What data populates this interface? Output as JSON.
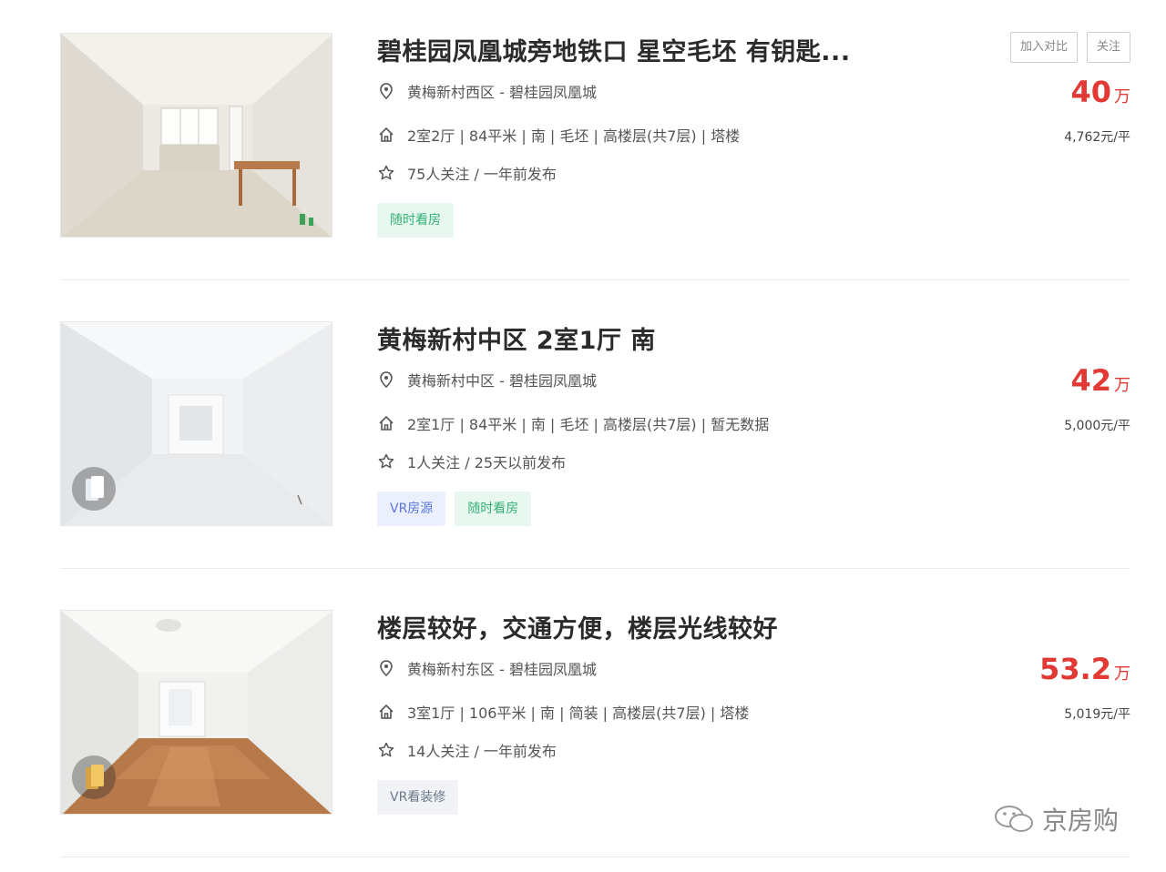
{
  "listings": [
    {
      "title": "碧桂园凤凰城旁地铁口 星空毛坯 有钥匙...",
      "location": "黄梅新村西区 - 碧桂园凤凰城",
      "specs": "2室2厅 | 84平米 | 南 | 毛坯 | 高楼层(共7层) | 塔楼",
      "followers": "75人关注 / 一年前发布",
      "tags": [
        "随时看房"
      ],
      "price": "40",
      "price_unit": "万",
      "unit_price": "4,762元/平",
      "actions": [
        "加入对比",
        "关注"
      ]
    },
    {
      "title": "黄梅新村中区 2室1厅 南",
      "location": "黄梅新村中区 - 碧桂园凤凰城",
      "specs": "2室1厅 | 84平米 | 南 | 毛坯 | 高楼层(共7层) | 暂无数据",
      "followers": "1人关注 / 25天以前发布",
      "tags": [
        "VR房源",
        "随时看房"
      ],
      "price": "42",
      "price_unit": "万",
      "unit_price": "5,000元/平"
    },
    {
      "title": "楼层较好，交通方便，楼层光线较好",
      "location": "黄梅新村东区 - 碧桂园凤凰城",
      "specs": "3室1厅 | 106平米 | 南 | 简装 | 高楼层(共7层) | 塔楼",
      "followers": "14人关注 / 一年前发布",
      "tags": [
        "VR看装修"
      ],
      "price": "53.2",
      "price_unit": "万",
      "unit_price": "5,019元/平"
    }
  ],
  "watermark": "京房购",
  "icons": {
    "location": "location-pin-icon",
    "house": "house-icon",
    "star": "star-icon",
    "vr": "vr-icon"
  },
  "colors": {
    "price": "#e33935",
    "tag_green": "#33b277",
    "tag_blue": "#5a78e0"
  }
}
